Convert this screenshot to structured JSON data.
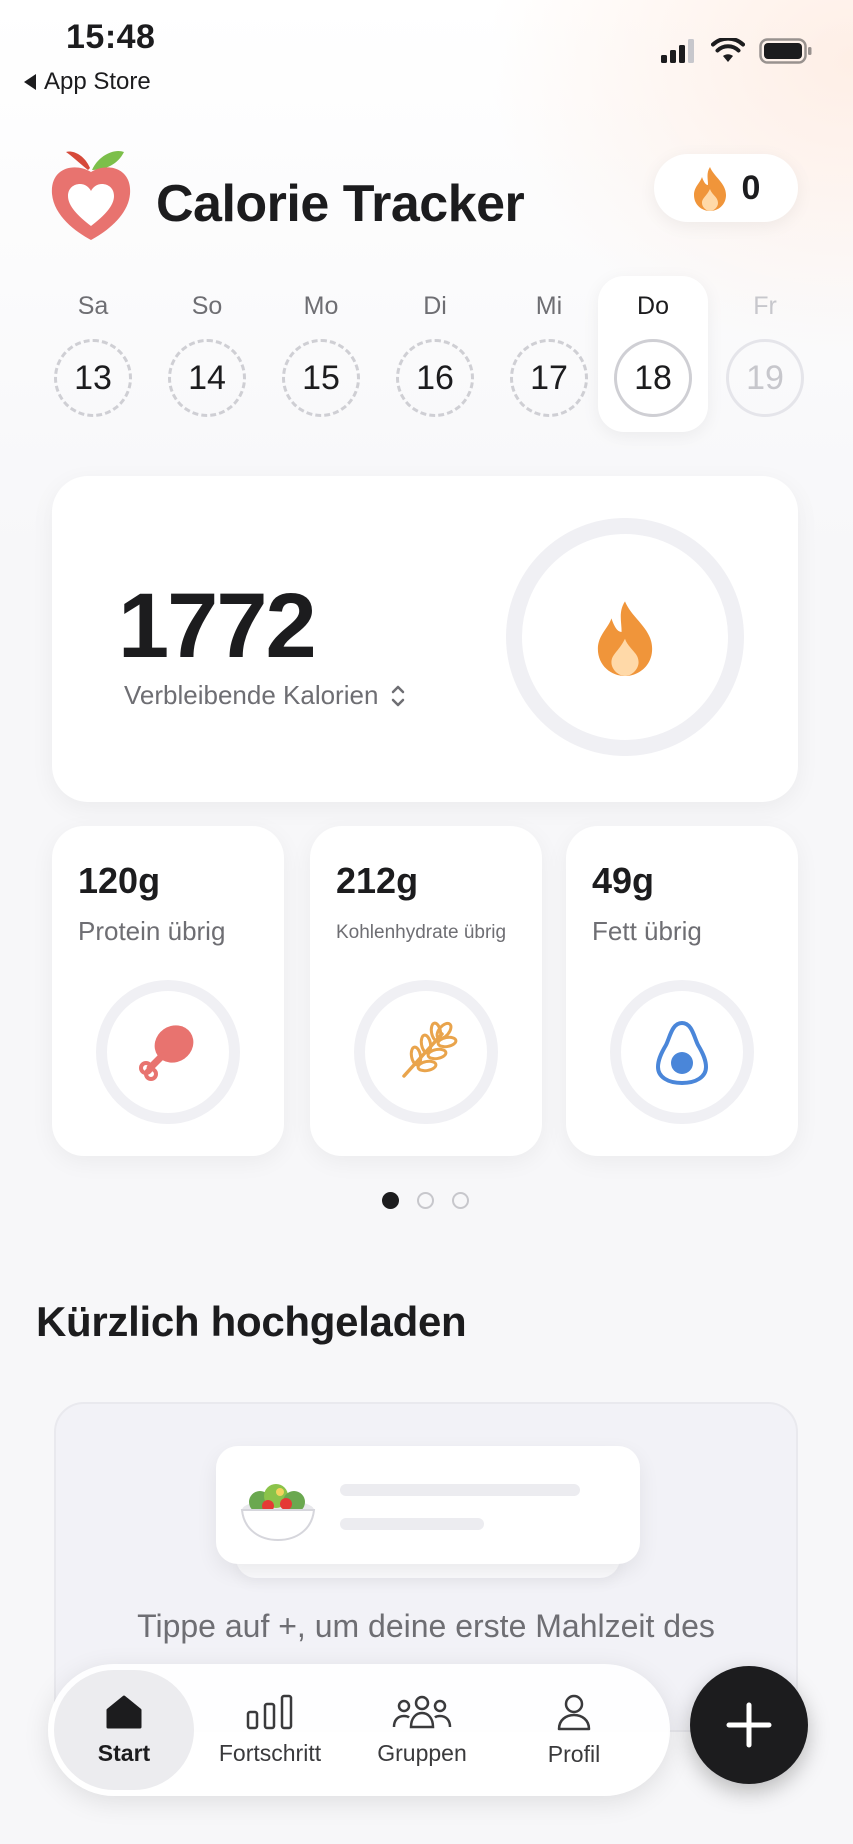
{
  "status_bar": {
    "time": "15:48",
    "back_label": "App Store"
  },
  "header": {
    "title": "Calorie Tracker",
    "streak_count": "0"
  },
  "days": [
    {
      "name": "Sa",
      "date": "13",
      "state": "past"
    },
    {
      "name": "So",
      "date": "14",
      "state": "past"
    },
    {
      "name": "Mo",
      "date": "15",
      "state": "past"
    },
    {
      "name": "Di",
      "date": "16",
      "state": "past"
    },
    {
      "name": "Mi",
      "date": "17",
      "state": "past"
    },
    {
      "name": "Do",
      "date": "18",
      "state": "selected"
    },
    {
      "name": "Fr",
      "date": "19",
      "state": "future"
    }
  ],
  "calories": {
    "value": "1772",
    "label": "Verbleibende Kalorien"
  },
  "macros": [
    {
      "value": "120g",
      "label": "Protein übrig",
      "icon": "drumstick-icon",
      "color": "#e8736f"
    },
    {
      "value": "212g",
      "label": "Kohlenhydrate übrig",
      "icon": "wheat-icon",
      "color": "#e9a44c"
    },
    {
      "value": "49g",
      "label": "Fett übrig",
      "icon": "avocado-icon",
      "color": "#4a86d9"
    }
  ],
  "pager": {
    "count": 3,
    "active": 0
  },
  "recent": {
    "title": "Kürzlich hochgeladen",
    "hint": "Tippe auf +, um deine erste Mahlzeit des"
  },
  "nav": {
    "tabs": [
      {
        "label": "Start",
        "icon": "home-icon",
        "active": true
      },
      {
        "label": "Fortschritt",
        "icon": "bar-chart-icon",
        "active": false
      },
      {
        "label": "Gruppen",
        "icon": "group-icon",
        "active": false
      },
      {
        "label": "Profil",
        "icon": "profile-icon",
        "active": false
      }
    ]
  },
  "colors": {
    "accent_dark": "#1c1c1e",
    "flame": "#f0953a",
    "logo_red": "#e8736f",
    "logo_leaf": "#7cbf4a"
  }
}
